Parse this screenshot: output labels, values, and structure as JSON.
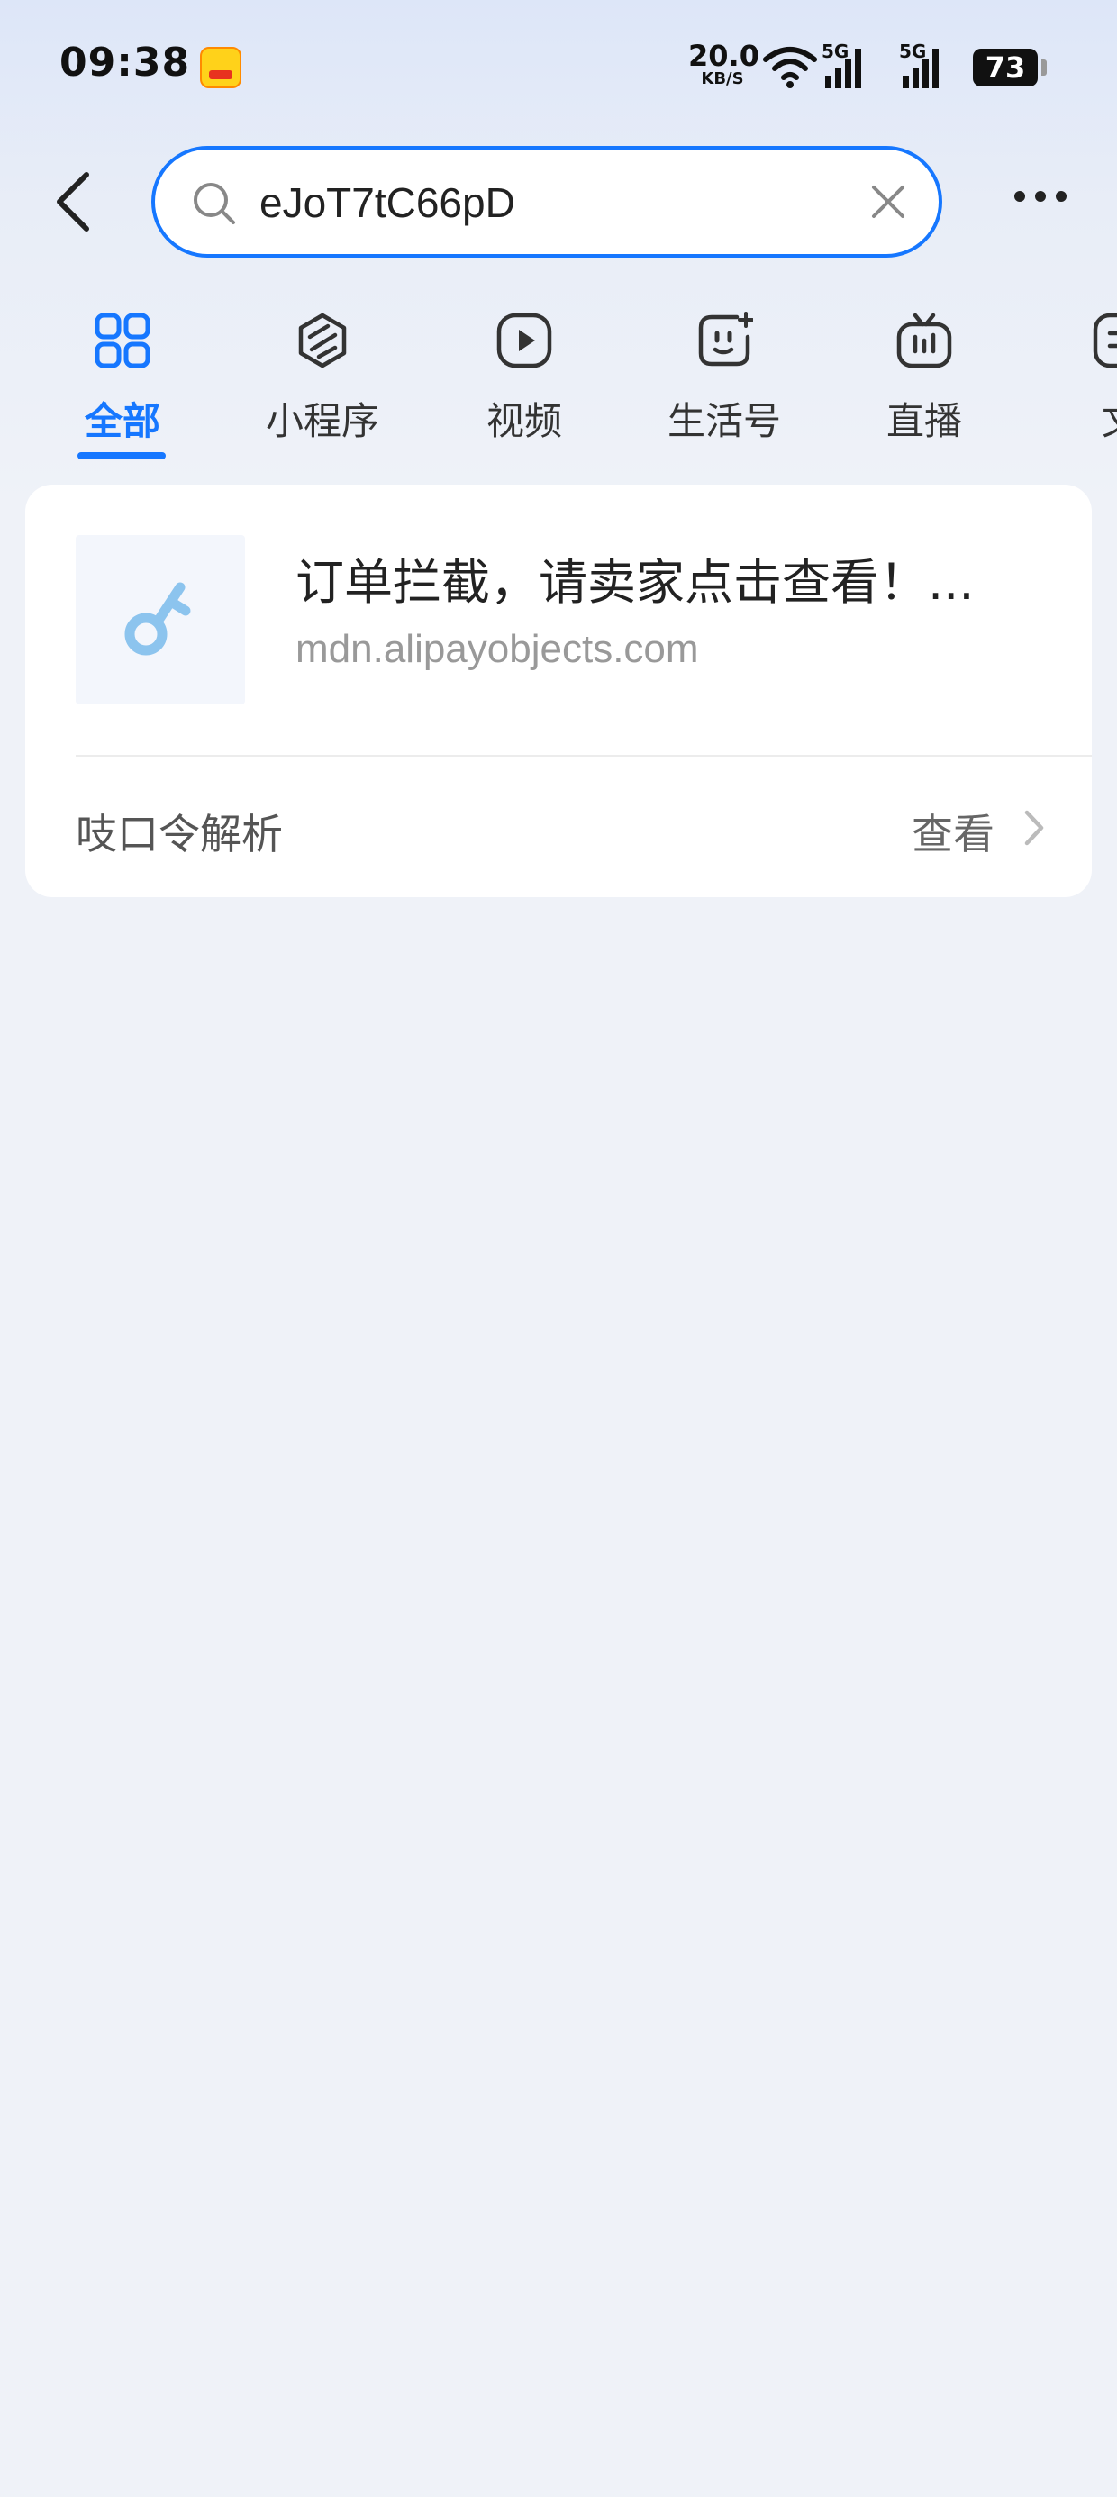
{
  "status_bar": {
    "time": "09:38",
    "net_speed_value": "20.0",
    "net_speed_unit": "KB/S",
    "signal_1": "5G",
    "signal_2": "5G",
    "battery": "73"
  },
  "search": {
    "value": "eJoT7tC66pD",
    "accent_color": "#1677ff"
  },
  "tabs": [
    {
      "label": "全部",
      "icon": "grid-icon",
      "active": true
    },
    {
      "label": "小程序",
      "icon": "mini-program-icon"
    },
    {
      "label": "视频",
      "icon": "video-play-icon"
    },
    {
      "label": "生活号",
      "icon": "life-account-icon"
    },
    {
      "label": "直播",
      "icon": "live-tv-icon"
    },
    {
      "label": "文",
      "icon": "article-icon"
    }
  ],
  "result": {
    "title": "订单拦截，请卖家点击查看！...",
    "url": "mdn.alipayobjects.com",
    "thumb_icon": "key-icon"
  },
  "action": {
    "label": "吱口令解析",
    "view": "查看"
  }
}
